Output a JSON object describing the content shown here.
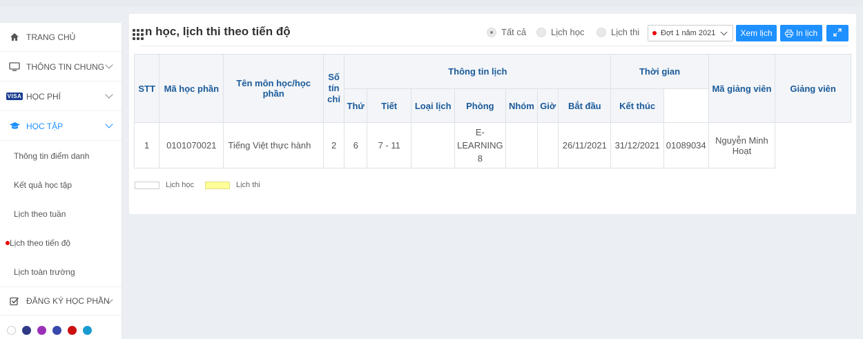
{
  "sidebar": {
    "home": "TRANG CHỦ",
    "general_info": "THÔNG TIN CHUNG",
    "tuition": "HỌC PHÍ",
    "tuition_badge": "VISA",
    "study": "HỌC TẬP",
    "sub_items": [
      {
        "label": "Thông tin điểm danh"
      },
      {
        "label": "Kết quả học tập"
      },
      {
        "label": "Lịch theo tuần"
      },
      {
        "label": "Lịch theo tiến độ"
      },
      {
        "label": "Lịch toàn trường"
      }
    ],
    "register": "ĐĂNG KÝ HỌC PHẦN",
    "theme_colors": [
      "#ffffff",
      "#2e3a87",
      "#9b30b8",
      "#3949ab",
      "#cc1010",
      "#1a9bd0"
    ]
  },
  "header": {
    "title": "n học, lịch thi theo tiến độ",
    "filter_all": "Tất cả",
    "filter_study": "Lịch học",
    "filter_exam": "Lịch thi",
    "period_select": "Đợt 1 năm 2021",
    "view_button": "Xem lịch",
    "print_button": "In lịch"
  },
  "table": {
    "headers": {
      "stt": "STT",
      "course_code": "Mã học phần",
      "course_name": "Tên môn học/học phần",
      "credits": "Số tín chỉ",
      "schedule_info": "Thông tin lịch",
      "day": "Thứ",
      "period": "Tiết",
      "type": "Loại lịch",
      "room": "Phòng",
      "group": "Nhóm",
      "hour": "Giờ",
      "time": "Thời gian",
      "start": "Bắt đầu",
      "end": "Kết thúc",
      "lecturer_code": "Mã giảng viên",
      "lecturer": "Giảng viên"
    },
    "rows": [
      {
        "stt": "1",
        "course_code": "0101070021",
        "course_name": "Tiếng Việt thực hành",
        "credits": "2",
        "day": "6",
        "period": "7 - 11",
        "type": "",
        "room": "E-LEARNING 8",
        "group": "",
        "hour": "",
        "start": "26/11/2021",
        "end": "31/12/2021",
        "lecturer_code": "01089034",
        "lecturer": "Nguyễn Minh Hoạt"
      }
    ]
  },
  "legend": {
    "study": "Lịch học",
    "exam": "Lịch thi",
    "exam_color": "#ffff99"
  },
  "colors": {
    "accent": "#1e90ff",
    "header_text": "#1a5a99"
  }
}
